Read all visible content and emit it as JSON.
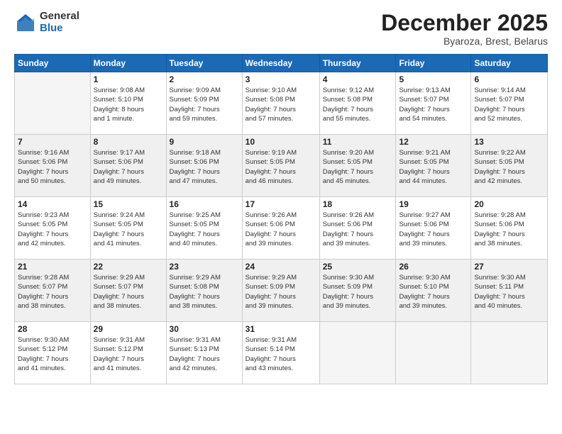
{
  "logo": {
    "general": "General",
    "blue": "Blue"
  },
  "title": "December 2025",
  "subtitle": "Byaroza, Brest, Belarus",
  "days_header": [
    "Sunday",
    "Monday",
    "Tuesday",
    "Wednesday",
    "Thursday",
    "Friday",
    "Saturday"
  ],
  "weeks": [
    [
      {
        "num": "",
        "info": ""
      },
      {
        "num": "1",
        "info": "Sunrise: 9:08 AM\nSunset: 5:10 PM\nDaylight: 8 hours\nand 1 minute."
      },
      {
        "num": "2",
        "info": "Sunrise: 9:09 AM\nSunset: 5:09 PM\nDaylight: 7 hours\nand 59 minutes."
      },
      {
        "num": "3",
        "info": "Sunrise: 9:10 AM\nSunset: 5:08 PM\nDaylight: 7 hours\nand 57 minutes."
      },
      {
        "num": "4",
        "info": "Sunrise: 9:12 AM\nSunset: 5:08 PM\nDaylight: 7 hours\nand 55 minutes."
      },
      {
        "num": "5",
        "info": "Sunrise: 9:13 AM\nSunset: 5:07 PM\nDaylight: 7 hours\nand 54 minutes."
      },
      {
        "num": "6",
        "info": "Sunrise: 9:14 AM\nSunset: 5:07 PM\nDaylight: 7 hours\nand 52 minutes."
      }
    ],
    [
      {
        "num": "7",
        "info": "Sunrise: 9:16 AM\nSunset: 5:06 PM\nDaylight: 7 hours\nand 50 minutes."
      },
      {
        "num": "8",
        "info": "Sunrise: 9:17 AM\nSunset: 5:06 PM\nDaylight: 7 hours\nand 49 minutes."
      },
      {
        "num": "9",
        "info": "Sunrise: 9:18 AM\nSunset: 5:06 PM\nDaylight: 7 hours\nand 47 minutes."
      },
      {
        "num": "10",
        "info": "Sunrise: 9:19 AM\nSunset: 5:05 PM\nDaylight: 7 hours\nand 46 minutes."
      },
      {
        "num": "11",
        "info": "Sunrise: 9:20 AM\nSunset: 5:05 PM\nDaylight: 7 hours\nand 45 minutes."
      },
      {
        "num": "12",
        "info": "Sunrise: 9:21 AM\nSunset: 5:05 PM\nDaylight: 7 hours\nand 44 minutes."
      },
      {
        "num": "13",
        "info": "Sunrise: 9:22 AM\nSunset: 5:05 PM\nDaylight: 7 hours\nand 42 minutes."
      }
    ],
    [
      {
        "num": "14",
        "info": "Sunrise: 9:23 AM\nSunset: 5:05 PM\nDaylight: 7 hours\nand 42 minutes."
      },
      {
        "num": "15",
        "info": "Sunrise: 9:24 AM\nSunset: 5:05 PM\nDaylight: 7 hours\nand 41 minutes."
      },
      {
        "num": "16",
        "info": "Sunrise: 9:25 AM\nSunset: 5:05 PM\nDaylight: 7 hours\nand 40 minutes."
      },
      {
        "num": "17",
        "info": "Sunrise: 9:26 AM\nSunset: 5:06 PM\nDaylight: 7 hours\nand 39 minutes."
      },
      {
        "num": "18",
        "info": "Sunrise: 9:26 AM\nSunset: 5:06 PM\nDaylight: 7 hours\nand 39 minutes."
      },
      {
        "num": "19",
        "info": "Sunrise: 9:27 AM\nSunset: 5:06 PM\nDaylight: 7 hours\nand 39 minutes."
      },
      {
        "num": "20",
        "info": "Sunrise: 9:28 AM\nSunset: 5:06 PM\nDaylight: 7 hours\nand 38 minutes."
      }
    ],
    [
      {
        "num": "21",
        "info": "Sunrise: 9:28 AM\nSunset: 5:07 PM\nDaylight: 7 hours\nand 38 minutes."
      },
      {
        "num": "22",
        "info": "Sunrise: 9:29 AM\nSunset: 5:07 PM\nDaylight: 7 hours\nand 38 minutes."
      },
      {
        "num": "23",
        "info": "Sunrise: 9:29 AM\nSunset: 5:08 PM\nDaylight: 7 hours\nand 38 minutes."
      },
      {
        "num": "24",
        "info": "Sunrise: 9:29 AM\nSunset: 5:09 PM\nDaylight: 7 hours\nand 39 minutes."
      },
      {
        "num": "25",
        "info": "Sunrise: 9:30 AM\nSunset: 5:09 PM\nDaylight: 7 hours\nand 39 minutes."
      },
      {
        "num": "26",
        "info": "Sunrise: 9:30 AM\nSunset: 5:10 PM\nDaylight: 7 hours\nand 39 minutes."
      },
      {
        "num": "27",
        "info": "Sunrise: 9:30 AM\nSunset: 5:11 PM\nDaylight: 7 hours\nand 40 minutes."
      }
    ],
    [
      {
        "num": "28",
        "info": "Sunrise: 9:30 AM\nSunset: 5:12 PM\nDaylight: 7 hours\nand 41 minutes."
      },
      {
        "num": "29",
        "info": "Sunrise: 9:31 AM\nSunset: 5:12 PM\nDaylight: 7 hours\nand 41 minutes."
      },
      {
        "num": "30",
        "info": "Sunrise: 9:31 AM\nSunset: 5:13 PM\nDaylight: 7 hours\nand 42 minutes."
      },
      {
        "num": "31",
        "info": "Sunrise: 9:31 AM\nSunset: 5:14 PM\nDaylight: 7 hours\nand 43 minutes."
      },
      {
        "num": "",
        "info": ""
      },
      {
        "num": "",
        "info": ""
      },
      {
        "num": "",
        "info": ""
      }
    ]
  ]
}
